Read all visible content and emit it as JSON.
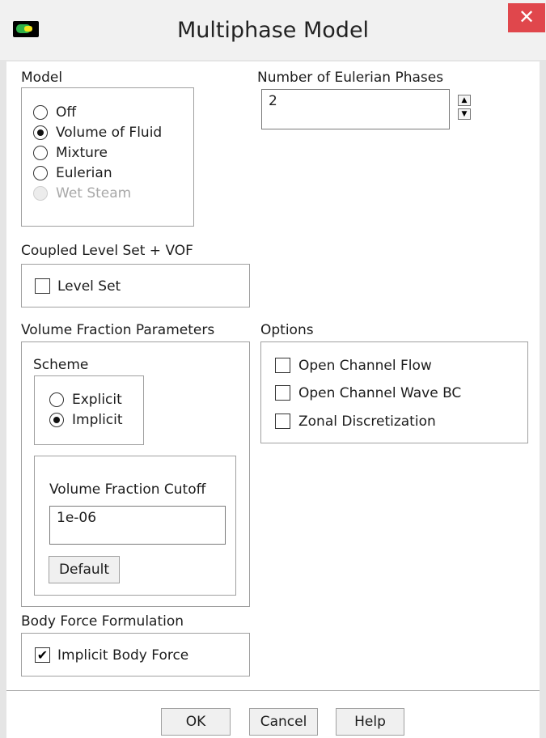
{
  "window": {
    "title": "Multiphase Model",
    "close": "✕"
  },
  "model": {
    "label": "Model",
    "options": [
      "Off",
      "Volume of Fluid",
      "Mixture",
      "Eulerian",
      "Wet Steam"
    ],
    "selected": "Volume of Fluid",
    "disabled": [
      "Wet Steam"
    ]
  },
  "phases": {
    "label": "Number of Eulerian Phases",
    "value": "2"
  },
  "coupled": {
    "label": "Coupled Level Set + VOF",
    "level_set": {
      "label": "Level Set",
      "checked": false
    }
  },
  "vfp": {
    "label": "Volume Fraction Parameters",
    "scheme": {
      "label": "Scheme",
      "options": [
        "Explicit",
        "Implicit"
      ],
      "selected": "Implicit"
    },
    "cutoff": {
      "label": "Volume Fraction Cutoff",
      "value": "1e-06",
      "default_label": "Default"
    }
  },
  "options": {
    "label": "Options",
    "items": [
      {
        "label": "Open Channel Flow",
        "checked": false
      },
      {
        "label": "Open Channel Wave BC",
        "checked": false
      },
      {
        "label": "Zonal Discretization",
        "checked": false
      }
    ]
  },
  "body_force": {
    "label": "Body Force Formulation",
    "implicit": {
      "label": "Implicit Body Force",
      "checked": true
    }
  },
  "buttons": {
    "ok": "OK",
    "cancel": "Cancel",
    "help": "Help"
  }
}
